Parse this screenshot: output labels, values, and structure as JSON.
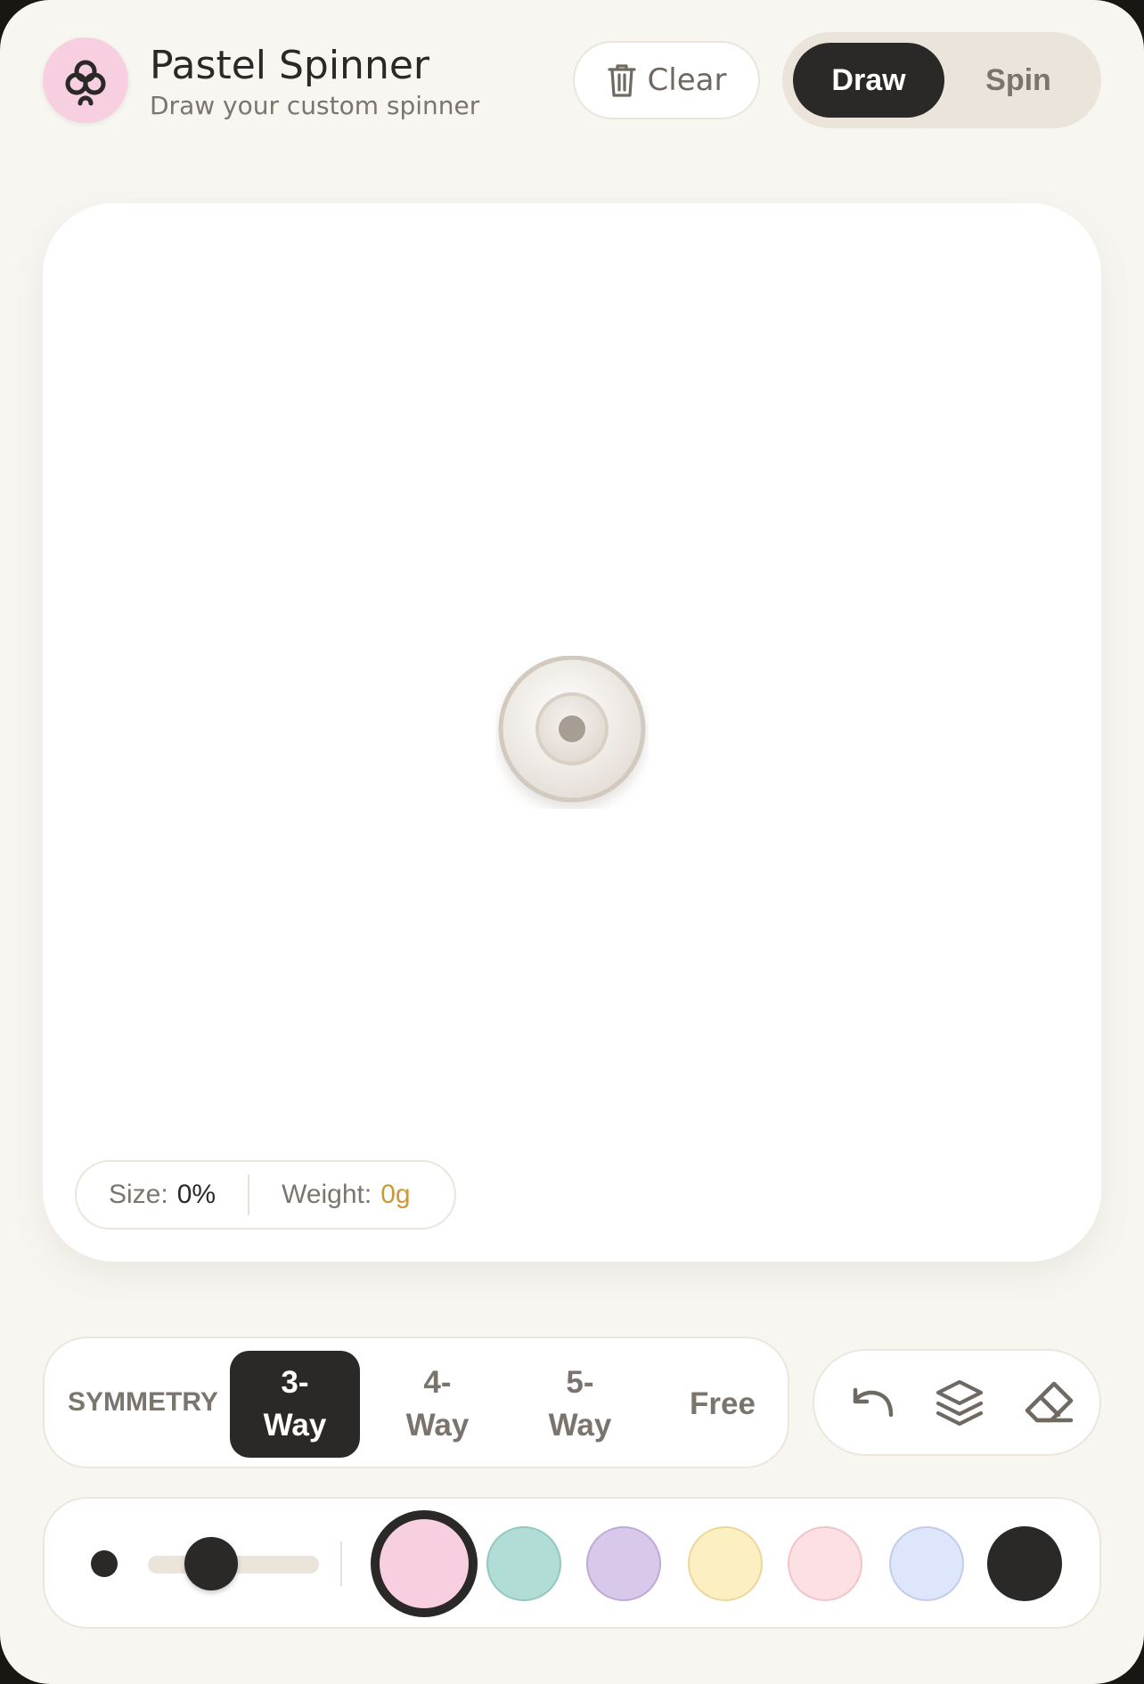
{
  "app": {
    "title": "Pastel Spinner",
    "subtitle": "Draw your custom spinner"
  },
  "header": {
    "logo_icon": "spinner-logo-icon",
    "clear_label": "Clear",
    "clear_icon": "trash-icon",
    "mode_toggle": {
      "options": [
        "Draw",
        "Spin"
      ],
      "selected": "Draw"
    }
  },
  "canvas": {
    "hub_icon": "spinner-hub",
    "stats": {
      "size_label": "Size:",
      "size_value": "0%",
      "weight_label": "Weight:",
      "weight_value": "0g"
    }
  },
  "symmetry": {
    "label": "SYMMETRY",
    "options": [
      {
        "line1": "3-",
        "line2": "Way"
      },
      {
        "line1": "4-",
        "line2": "Way"
      },
      {
        "line1": "5-",
        "line2": "Way"
      },
      {
        "line1": "Free",
        "line2": ""
      }
    ],
    "selected_index": 0
  },
  "tools": [
    {
      "name": "undo",
      "icon": "undo-icon"
    },
    {
      "name": "layers",
      "icon": "layers-icon"
    },
    {
      "name": "eraser",
      "icon": "eraser-icon"
    }
  ],
  "brush": {
    "size_fraction": 0.36
  },
  "palette": {
    "colors": [
      {
        "name": "pink",
        "hex": "#f8cfe0",
        "border": "#2b2927"
      },
      {
        "name": "mint",
        "hex": "#b2ddd6",
        "border": "#93c8bf"
      },
      {
        "name": "lavender",
        "hex": "#d8c8ea",
        "border": "#bfaad8"
      },
      {
        "name": "butter",
        "hex": "#fcefc2",
        "border": "#ecd89a"
      },
      {
        "name": "blush",
        "hex": "#fde0e4",
        "border": "#f0c4ca"
      },
      {
        "name": "periwinkle",
        "hex": "#dde6fb",
        "border": "#c2cdec"
      },
      {
        "name": "charcoal",
        "hex": "#2b2927",
        "border": "#2b2927"
      }
    ],
    "selected_index": 0
  },
  "theme": {
    "background": "#f8f6f1",
    "ink": "#2b2927",
    "muted": "#7c756e",
    "accent_weight": "#c99a36"
  }
}
